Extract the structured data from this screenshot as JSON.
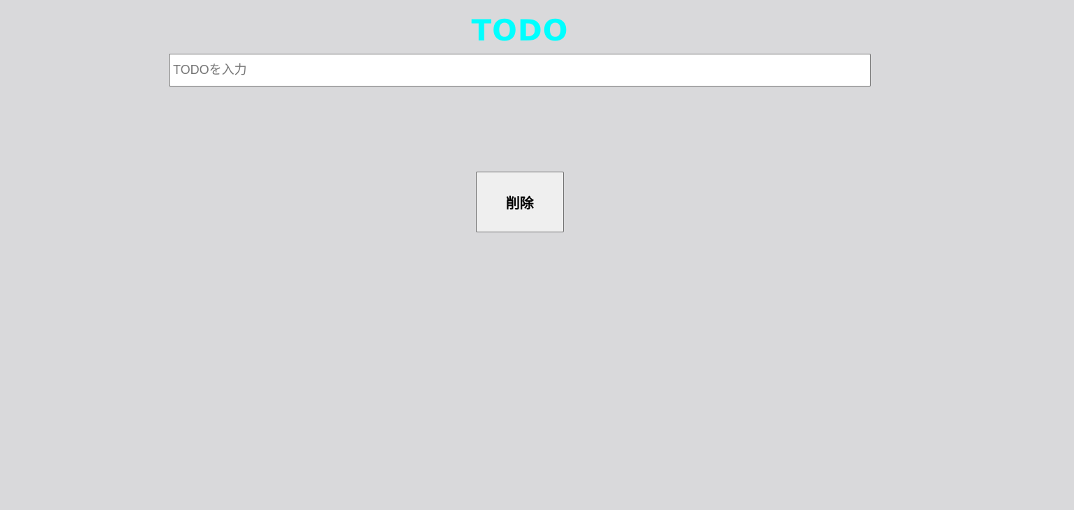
{
  "header": {
    "title": "TODO",
    "title_color": "#00ffff"
  },
  "input": {
    "value": "",
    "placeholder": "TODOを入力"
  },
  "actions": {
    "delete_label": "削除"
  },
  "colors": {
    "background": "#d9d9db",
    "input_background": "#ffffff",
    "button_background": "#efefef"
  }
}
